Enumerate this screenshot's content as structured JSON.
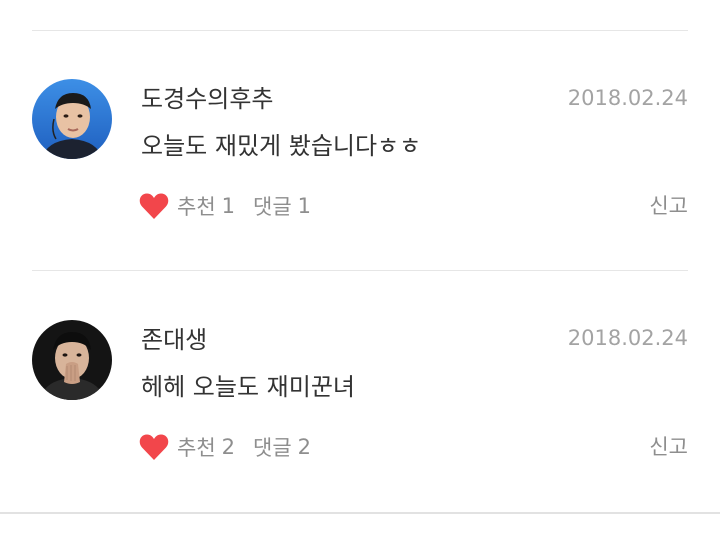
{
  "comments": [
    {
      "author": "도경수의후추",
      "date": "2018.02.24",
      "text": "오늘도 재밌게 봤습니다ㅎㅎ",
      "recommend_label": "추천",
      "recommend_count": "1",
      "reply_label": "댓글",
      "reply_count": "1",
      "report_label": "신고"
    },
    {
      "author": "존대생",
      "date": "2018.02.24",
      "text": "헤헤 오늘도 재미꾼녀",
      "recommend_label": "추천",
      "recommend_count": "2",
      "reply_label": "댓글",
      "reply_count": "2",
      "report_label": "신고"
    }
  ],
  "icons": {
    "recommend": "heart-icon"
  },
  "colors": {
    "heart": "#f2464b",
    "date": "#a3a3a3",
    "meta": "#8e8e8e",
    "text": "#333333"
  }
}
